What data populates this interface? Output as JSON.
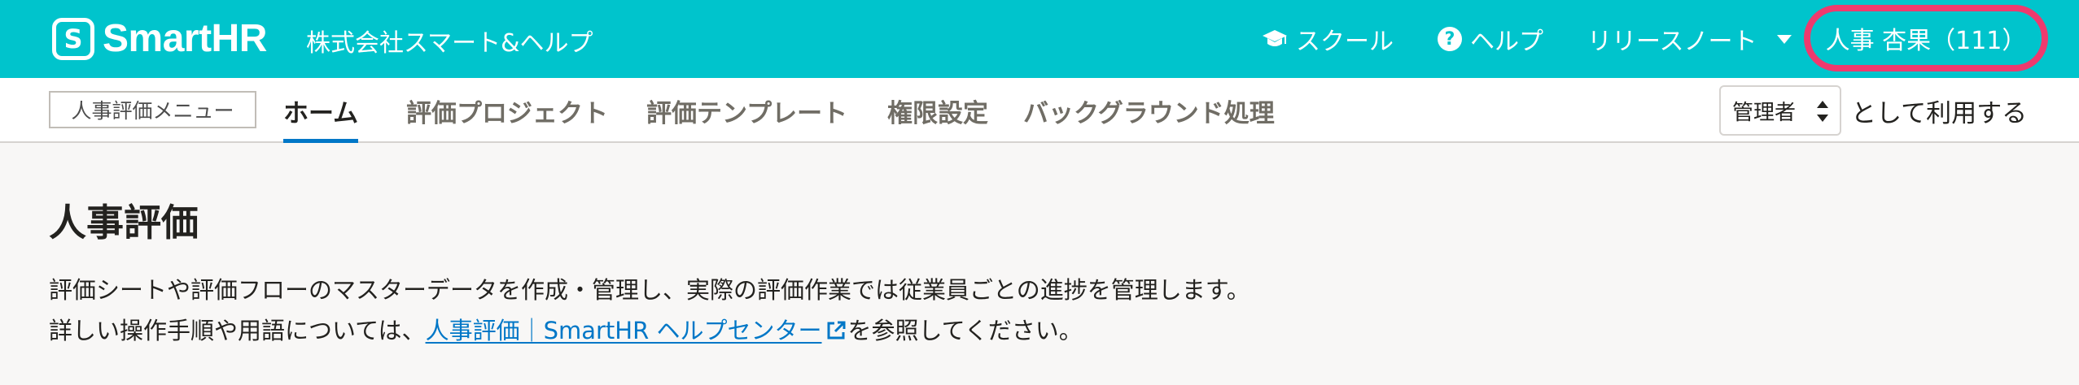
{
  "header": {
    "logo_mark": "S",
    "logo_text": "SmartHR",
    "tenant_name": "株式会社スマート&ヘルプ",
    "nav": {
      "school_label": "スクール",
      "help_label": "ヘルプ",
      "release_notes_label": "リリースノート"
    },
    "user_label": "人事 杏果（111）"
  },
  "subnav": {
    "menu_label": "人事評価メニュー",
    "tabs": [
      {
        "label": "ホーム",
        "active": true
      },
      {
        "label": "評価プロジェクト",
        "active": false
      },
      {
        "label": "評価テンプレート",
        "active": false
      },
      {
        "label": "権限設定",
        "active": false
      },
      {
        "label": "バックグラウンド処理",
        "active": false
      }
    ],
    "role_select_value": "管理者",
    "role_suffix": "として利用する"
  },
  "main": {
    "title": "人事評価",
    "description_line1": "評価シートや評価フローのマスターデータを作成・管理し、実際の評価作業では従業員ごとの進捗を管理します。",
    "description_line2_prefix": "詳しい操作手順や用語については、",
    "help_link_text": "人事評価｜SmartHR ヘルプセンター",
    "description_line2_suffix": "を参照してください。"
  },
  "colors": {
    "brand": "#00c4cc",
    "highlight_ring": "#ee3a6e",
    "link": "#0077c7"
  },
  "icons": [
    "graduation-cap-icon",
    "help-circle-icon",
    "chevron-down-icon",
    "sort-icon",
    "external-link-icon"
  ]
}
